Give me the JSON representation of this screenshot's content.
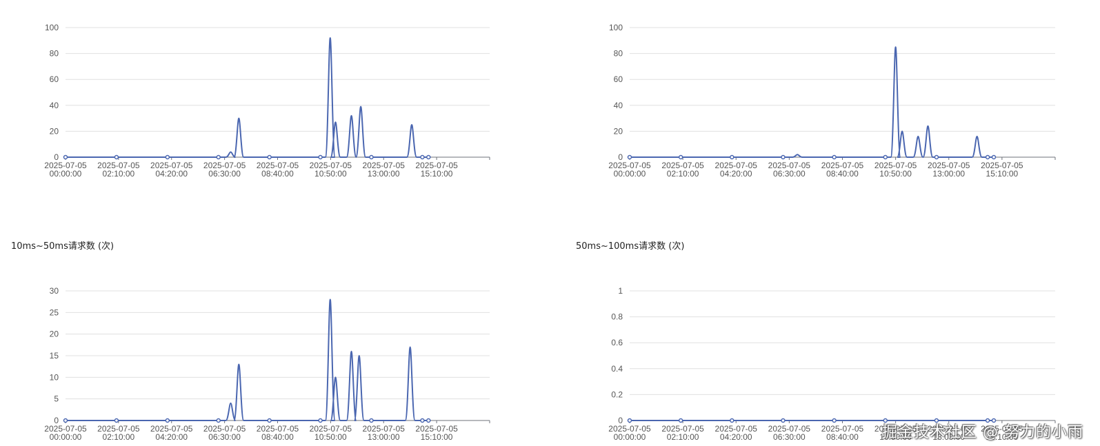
{
  "charts_meta": {
    "line_color": "#4a66b0",
    "grid_color": "#e0e0e0",
    "axis_text_color": "#555555"
  },
  "chart_data": [
    {
      "type": "line",
      "title": "",
      "x_ticks": [
        [
          "2025-07-05",
          "00:00:00"
        ],
        [
          "2025-07-05",
          "02:10:00"
        ],
        [
          "2025-07-05",
          "04:20:00"
        ],
        [
          "2025-07-05",
          "06:30:00"
        ],
        [
          "2025-07-05",
          "08:40:00"
        ],
        [
          "2025-07-05",
          "10:50:00"
        ],
        [
          "2025-07-05",
          "13:00:00"
        ],
        [
          "2025-07-05",
          "15:10:00"
        ]
      ],
      "xlim_minutes": [
        0,
        940
      ],
      "ylim": [
        0,
        100
      ],
      "y_ticks": [
        0,
        20,
        40,
        60,
        80,
        100
      ],
      "grid": true,
      "series": [
        {
          "values": [
            [
              0,
              0
            ],
            [
              125,
              0
            ],
            [
              250,
              0
            ],
            [
              375,
              0
            ],
            [
              405,
              4
            ],
            [
              425,
              30
            ],
            [
              500,
              0
            ],
            [
              625,
              0
            ],
            [
              649,
              92
            ],
            [
              662,
              27
            ],
            [
              701,
              32
            ],
            [
              724,
              39
            ],
            [
              750,
              0
            ],
            [
              849,
              25
            ],
            [
              875,
              0
            ],
            [
              890,
              0
            ]
          ]
        }
      ]
    },
    {
      "type": "line",
      "title": "",
      "x_ticks": [
        [
          "2025-07-05",
          "00:00:00"
        ],
        [
          "2025-07-05",
          "02:10:00"
        ],
        [
          "2025-07-05",
          "04:20:00"
        ],
        [
          "2025-07-05",
          "06:30:00"
        ],
        [
          "2025-07-05",
          "08:40:00"
        ],
        [
          "2025-07-05",
          "10:50:00"
        ],
        [
          "2025-07-05",
          "13:00:00"
        ],
        [
          "2025-07-05",
          "15:10:00"
        ]
      ],
      "xlim_minutes": [
        0,
        940
      ],
      "ylim": [
        0,
        100
      ],
      "y_ticks": [
        0,
        20,
        40,
        60,
        80,
        100
      ],
      "grid": true,
      "series": [
        {
          "values": [
            [
              0,
              0
            ],
            [
              125,
              0
            ],
            [
              250,
              0
            ],
            [
              375,
              0
            ],
            [
              410,
              2
            ],
            [
              500,
              0
            ],
            [
              625,
              0
            ],
            [
              650,
              85
            ],
            [
              666,
              20
            ],
            [
              705,
              16
            ],
            [
              729,
              24
            ],
            [
              750,
              0
            ],
            [
              849,
              16
            ],
            [
              875,
              0
            ],
            [
              890,
              0
            ]
          ]
        }
      ]
    },
    {
      "type": "line",
      "title": "10ms~50ms请求数 (次)",
      "x_ticks": [
        [
          "2025-07-05",
          "00:00:00"
        ],
        [
          "2025-07-05",
          "02:10:00"
        ],
        [
          "2025-07-05",
          "04:20:00"
        ],
        [
          "2025-07-05",
          "06:30:00"
        ],
        [
          "2025-07-05",
          "08:40:00"
        ],
        [
          "2025-07-05",
          "10:50:00"
        ],
        [
          "2025-07-05",
          "13:00:00"
        ],
        [
          "2025-07-05",
          "15:10:00"
        ]
      ],
      "xlim_minutes": [
        0,
        940
      ],
      "ylim": [
        0,
        30
      ],
      "y_ticks": [
        0,
        5,
        10,
        15,
        20,
        25,
        30
      ],
      "grid": true,
      "series": [
        {
          "values": [
            [
              0,
              0
            ],
            [
              125,
              0
            ],
            [
              250,
              0
            ],
            [
              375,
              0
            ],
            [
              405,
              4
            ],
            [
              425,
              13
            ],
            [
              500,
              0
            ],
            [
              625,
              0
            ],
            [
              649,
              28
            ],
            [
              662,
              10
            ],
            [
              701,
              16
            ],
            [
              720,
              15
            ],
            [
              750,
              0
            ],
            [
              845,
              17
            ],
            [
              875,
              0
            ],
            [
              890,
              0
            ]
          ]
        }
      ]
    },
    {
      "type": "line",
      "title": "50ms~100ms请求数 (次)",
      "x_ticks": [
        [
          "2025-07-05",
          "00:00:00"
        ],
        [
          "2025-07-05",
          "02:10:00"
        ],
        [
          "2025-07-05",
          "04:20:00"
        ],
        [
          "2025-07-05",
          "06:30:00"
        ],
        [
          "2025-07-05",
          "08:40:00"
        ],
        [
          "2025-07-05",
          "10:50:00"
        ],
        [
          "2025-07-05",
          "13:00:00"
        ],
        [
          "2025-07-05",
          "15:10:00"
        ]
      ],
      "xlim_minutes": [
        0,
        940
      ],
      "ylim": [
        0,
        1
      ],
      "y_ticks": [
        0,
        0.2,
        0.4,
        0.6,
        0.8,
        1
      ],
      "grid": true,
      "series": [
        {
          "values": [
            [
              0,
              0
            ],
            [
              125,
              0
            ],
            [
              250,
              0
            ],
            [
              375,
              0
            ],
            [
              500,
              0
            ],
            [
              625,
              0
            ],
            [
              750,
              0
            ],
            [
              875,
              0
            ],
            [
              890,
              0
            ]
          ]
        }
      ]
    }
  ],
  "watermark": "掘金技术社区 @ 努力的小雨"
}
